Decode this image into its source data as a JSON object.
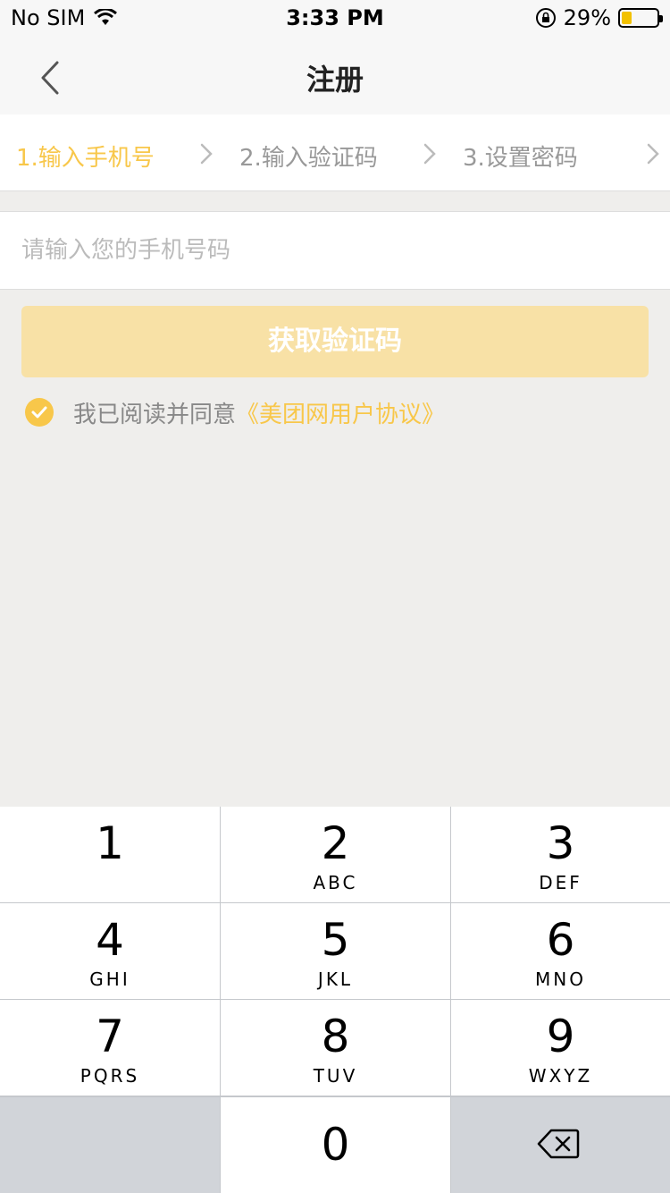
{
  "status_bar": {
    "carrier": "No SIM",
    "time": "3:33 PM",
    "battery_percent": "29%",
    "battery_level": 0.29,
    "icons": [
      "wifi-icon",
      "orientation-lock-icon",
      "battery-icon"
    ]
  },
  "nav": {
    "title": "注册",
    "back_icon": "chevron-left-icon"
  },
  "steps": [
    {
      "label": "1.输入手机号",
      "active": true
    },
    {
      "label": "2.输入验证码",
      "active": false
    },
    {
      "label": "3.设置密码",
      "active": false
    }
  ],
  "phone": {
    "placeholder": "请输入您的手机号码",
    "value": ""
  },
  "get_code_button": "获取验证码",
  "agreement": {
    "checked": true,
    "text": "我已阅读并同意",
    "link": "《美团网用户协议》"
  },
  "keypad": {
    "keys": [
      {
        "num": "1",
        "letters": ""
      },
      {
        "num": "2",
        "letters": "ABC"
      },
      {
        "num": "3",
        "letters": "DEF"
      },
      {
        "num": "4",
        "letters": "GHI"
      },
      {
        "num": "5",
        "letters": "JKL"
      },
      {
        "num": "6",
        "letters": "MNO"
      },
      {
        "num": "7",
        "letters": "PQRS"
      },
      {
        "num": "8",
        "letters": "TUV"
      },
      {
        "num": "9",
        "letters": "WXYZ"
      },
      {
        "num": "0",
        "letters": ""
      }
    ],
    "delete_icon": "backspace-icon"
  },
  "colors": {
    "accent": "#f8c74a",
    "button_disabled": "#f8e1a6",
    "background": "#efeeec"
  }
}
